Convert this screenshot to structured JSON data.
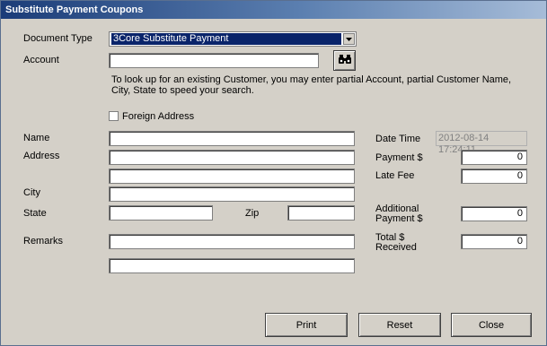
{
  "window": {
    "title": "Substitute Payment Coupons"
  },
  "form": {
    "document_type_label": "Document Type",
    "document_type_value": "3Core Substitute Payment",
    "account_label": "Account",
    "account_value": "",
    "help_line1": "To look up for an existing Customer, you may enter partial Account, partial Customer Name,",
    "help_line2": "City, State to speed your search.",
    "foreign_address_label": "Foreign Address",
    "foreign_address_checked": false,
    "name_label": "Name",
    "address_label": "Address",
    "city_label": "City",
    "state_label": "State",
    "zip_label": "Zip",
    "remarks_label": "Remarks",
    "date_time_label": "Date Time",
    "date_time_value": "2012-08-14 17:24:11",
    "payment_label": "Payment $",
    "payment_value": "0",
    "late_fee_label": "Late Fee",
    "late_fee_value": "0",
    "additional_label_line1": "Additional",
    "additional_label_line2": "Payment $",
    "additional_value": "0",
    "total_label_line1": "Total $",
    "total_label_line2": "Received",
    "total_value": "0"
  },
  "buttons": {
    "print": "Print",
    "reset": "Reset",
    "close": "Close"
  },
  "icons": {
    "lookup": "binoculars-icon",
    "dropdown": "chevron-down-icon"
  }
}
